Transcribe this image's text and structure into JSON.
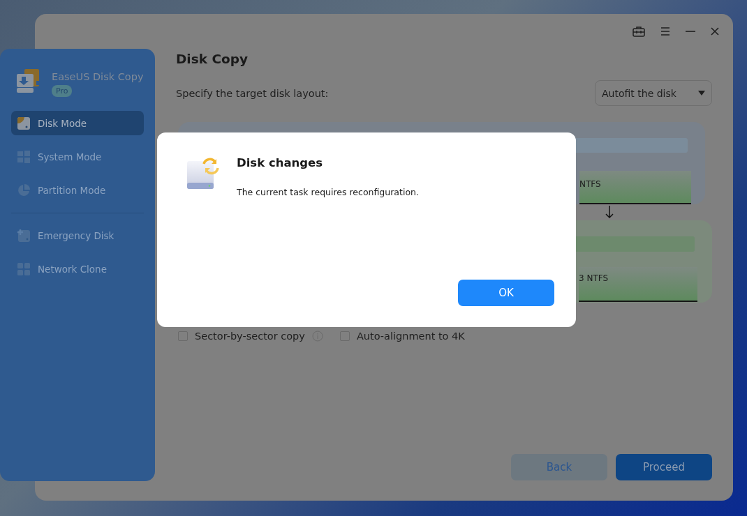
{
  "app": {
    "name": "EaseUS Disk Copy",
    "badge": "Pro"
  },
  "sidebar": {
    "sections": [
      {
        "items": [
          {
            "label": "Disk Mode",
            "selected": true,
            "kind": "disk"
          },
          {
            "label": "System Mode",
            "selected": false,
            "kind": "windows"
          },
          {
            "label": "Partition Mode",
            "selected": false,
            "kind": "pie"
          }
        ]
      },
      {
        "items": [
          {
            "label": "Emergency Disk",
            "selected": false,
            "kind": "plusdisk"
          },
          {
            "label": "Network Clone",
            "selected": false,
            "kind": "grid"
          }
        ]
      }
    ]
  },
  "page": {
    "title": "Disk Copy",
    "layout_label": "Specify the target disk layout:",
    "layout_select": {
      "value": "Autofit the disk"
    }
  },
  "source_disk": {
    "partition_label": "NTFS"
  },
  "target_disk": {
    "partition_label": "3 NTFS"
  },
  "options": [
    {
      "label": "Sector-by-sector copy",
      "checked": false,
      "info": true
    },
    {
      "label": "Auto-alignment to 4K",
      "checked": false,
      "info": false
    }
  ],
  "buttons": [
    {
      "label": "Back",
      "kind": "secondary"
    },
    {
      "label": "Proceed",
      "kind": "primary"
    }
  ],
  "dialog": {
    "title": "Disk changes",
    "message": "The current task requires reconfiguration.",
    "button": "OK"
  }
}
